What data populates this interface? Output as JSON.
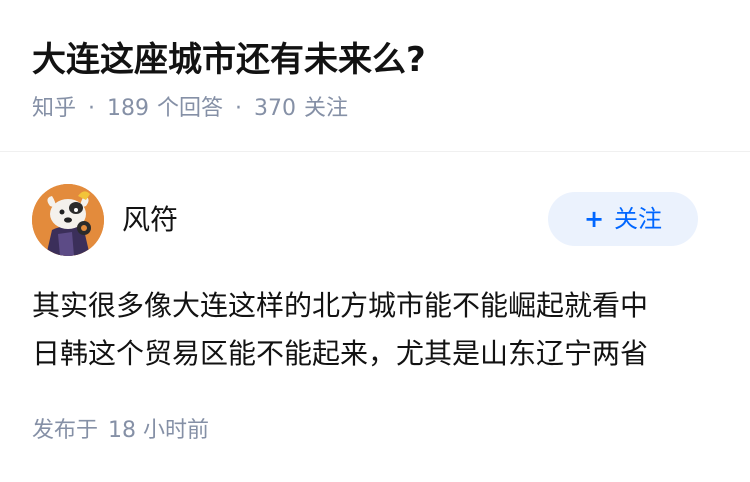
{
  "question": {
    "title": "大连这座城市还有未来么?",
    "source": "知乎",
    "answer_count": "189",
    "answer_label": "个回答",
    "follower_count": "370",
    "follower_label": "关注",
    "separator": "·"
  },
  "answer": {
    "author_name": "风符",
    "follow_plus": "+",
    "follow_label": "关注",
    "content_lines": [
      "其实很多像大连这样的北方城市能不能崛起就看中",
      "日韩这个贸易区能不能起来，尤其是山东辽宁两省"
    ],
    "time_label": "发布于",
    "time_value": "18 小时前"
  },
  "colors": {
    "accent": "#0066ff",
    "follow_bg": "#ebf2fd",
    "meta_text": "#8590a6",
    "avatar_bg": "#e38b3c"
  },
  "icons": {
    "avatar": "dog-cartoon-avatar"
  }
}
